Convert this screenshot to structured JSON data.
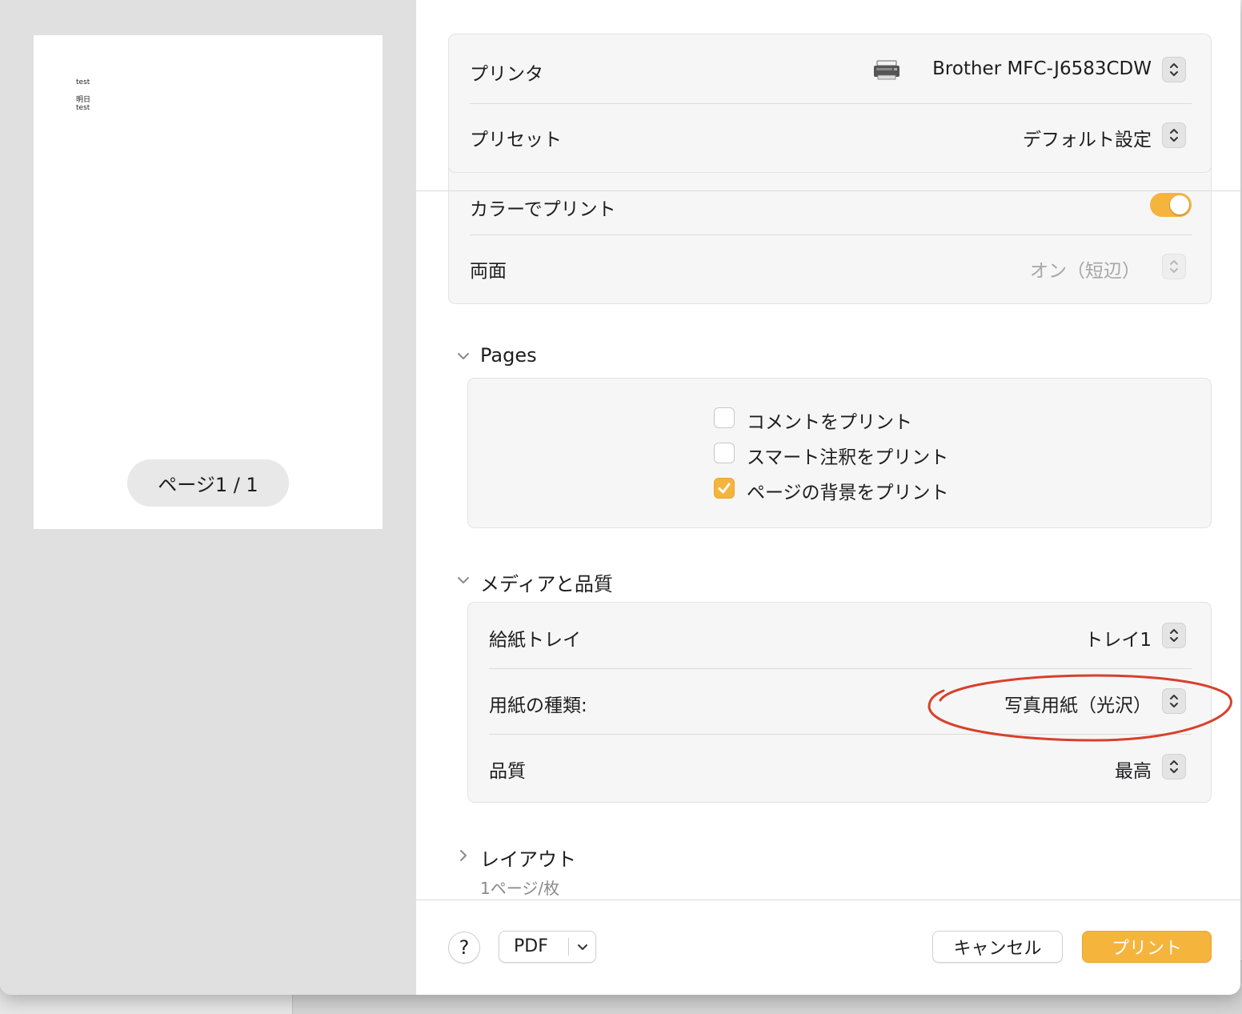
{
  "preview": {
    "doc_lines": [
      "test",
      "明日",
      "test"
    ],
    "page_indicator": "ページ1 / 1"
  },
  "top_card": {
    "printer_label": "プリンタ",
    "printer_value": "Brother MFC-J6583CDW",
    "preset_label": "プリセット",
    "preset_value": "デフォルト設定"
  },
  "options_card": {
    "color_label": "カラーでプリント",
    "color_on": true,
    "duplex_label": "両面",
    "duplex_value": "オン（短辺）"
  },
  "pages_section": {
    "title": "Pages",
    "options": [
      {
        "label": "コメントをプリント",
        "checked": false
      },
      {
        "label": "スマート注釈をプリント",
        "checked": false
      },
      {
        "label": "ページの背景をプリント",
        "checked": true
      }
    ]
  },
  "media_section": {
    "title": "メディアと品質",
    "tray_label": "給紙トレイ",
    "tray_value": "トレイ1",
    "paper_type_label": "用紙の種類:",
    "paper_type_value": "写真用紙（光沢）",
    "quality_label": "品質",
    "quality_value": "最高"
  },
  "layout_section": {
    "title": "レイアウト",
    "summary": "1ページ/枚"
  },
  "footer": {
    "help_label": "?",
    "pdf_label": "PDF",
    "cancel_label": "キャンセル",
    "print_label": "プリント"
  },
  "colors": {
    "accent": "#f5b43c",
    "annotation": "#d8402b"
  }
}
